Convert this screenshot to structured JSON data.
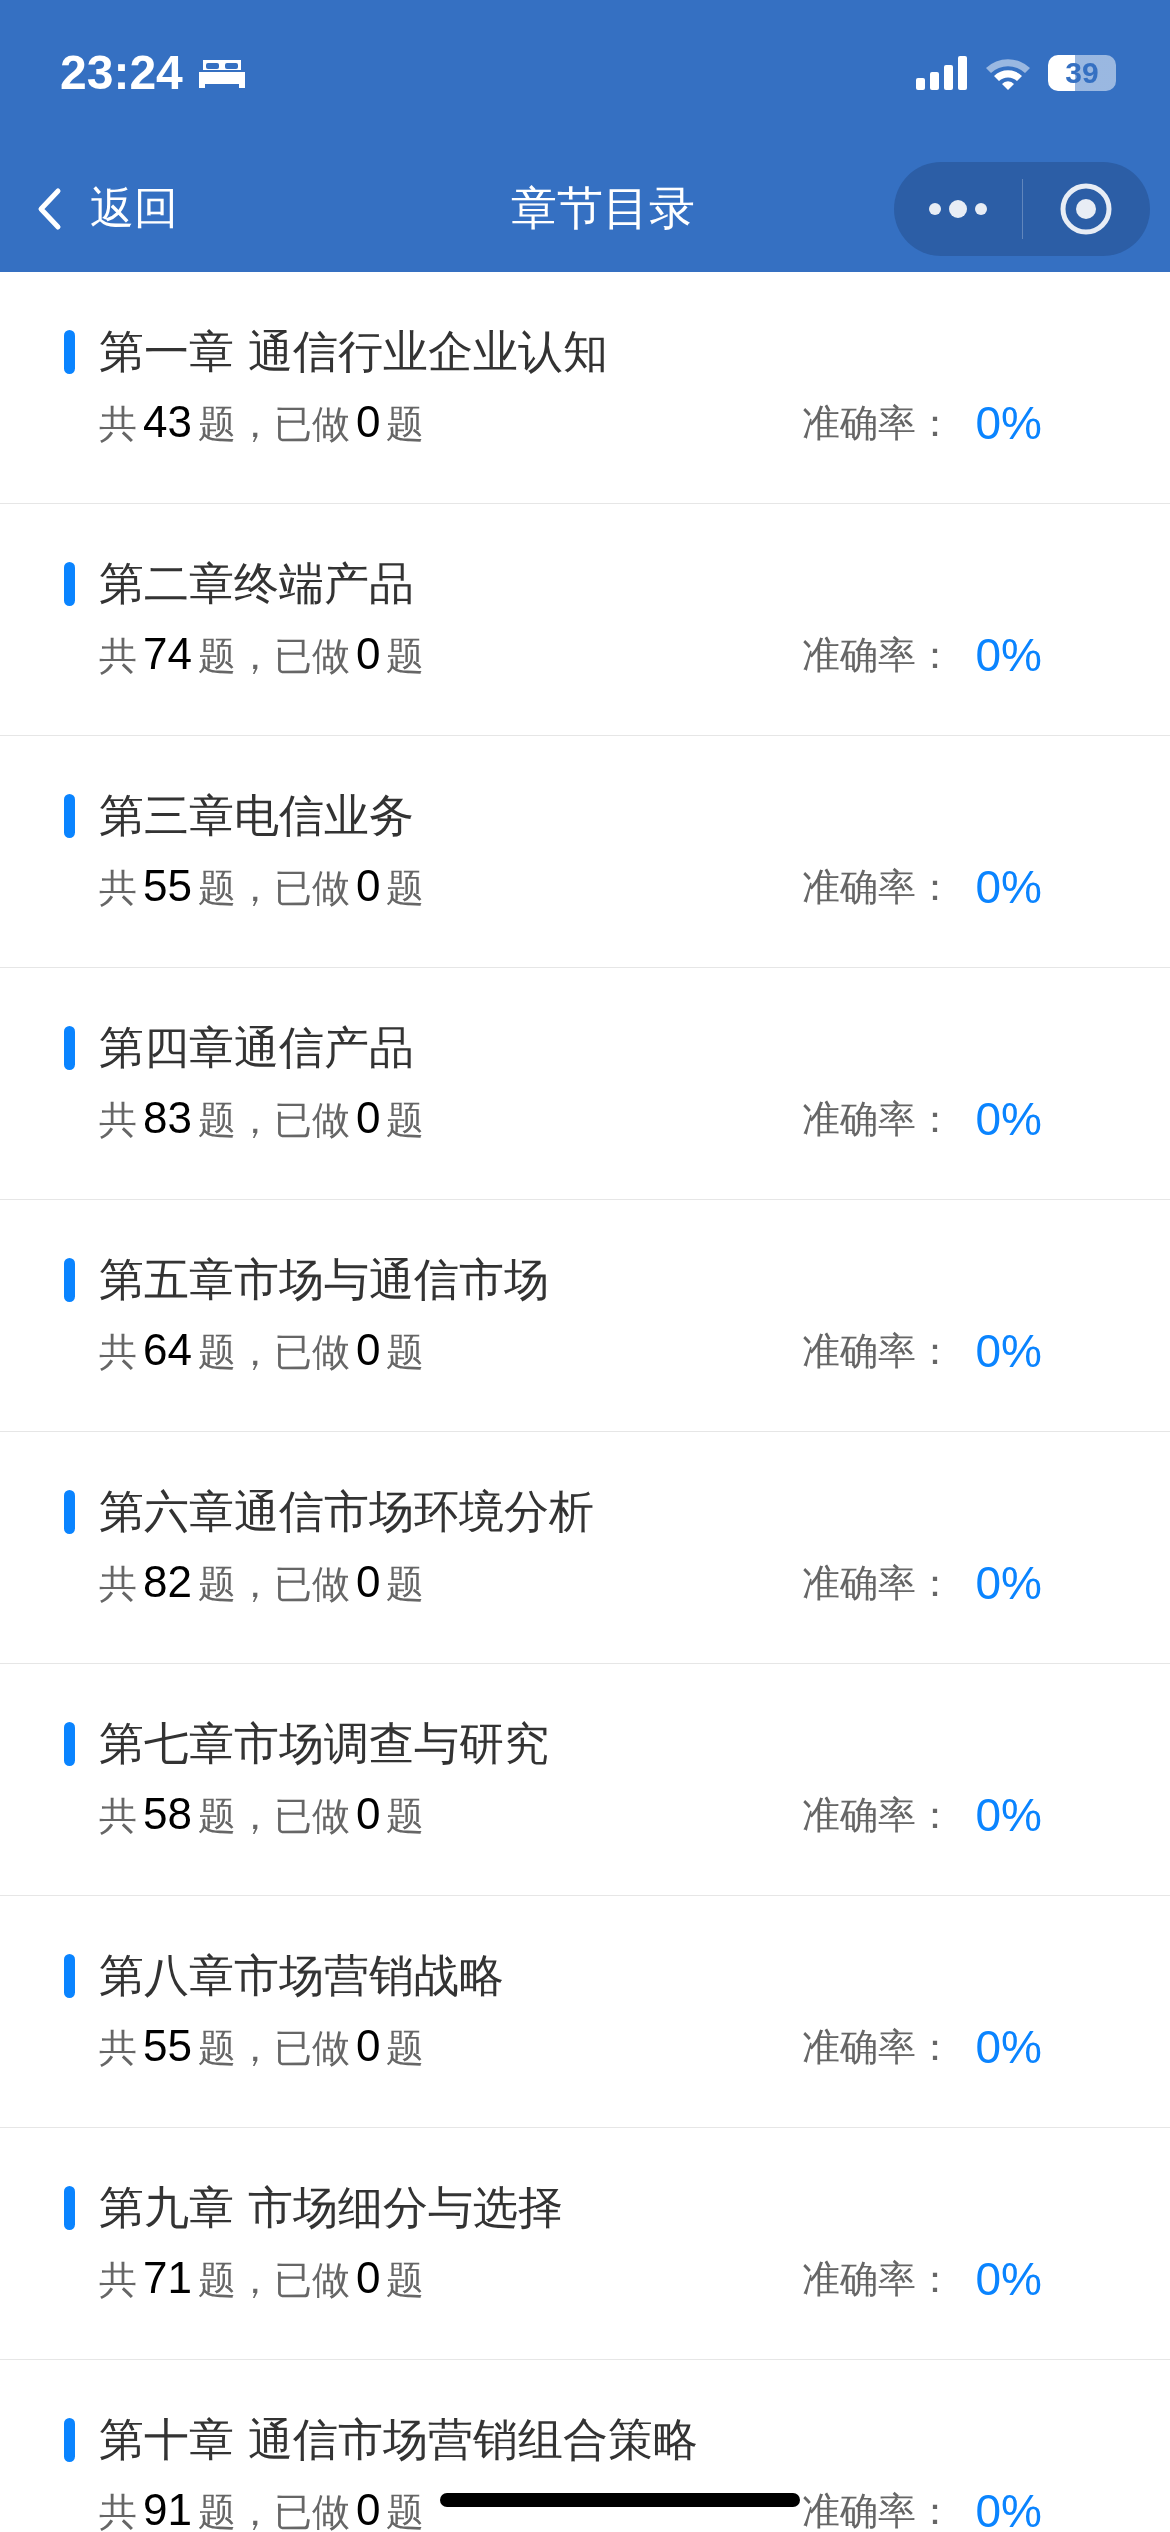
{
  "status_bar": {
    "time": "23:24",
    "battery": "39"
  },
  "nav": {
    "back": "返回",
    "title": "章节目录"
  },
  "chapters": [
    {
      "title": "第一章 通信行业企业认知",
      "stats": "共**43**题，已做**0**题",
      "accuracy_label": "准确率：",
      "accuracy": "0%"
    },
    {
      "title": "第二章终端产品",
      "stats": "共**74**题，已做**0**题",
      "accuracy_label": "准确率：",
      "accuracy": "0%"
    },
    {
      "title": "第三章电信业务",
      "stats": "共**55**题，已做**0**题",
      "accuracy_label": "准确率：",
      "accuracy": "0%"
    },
    {
      "title": "第四章通信产品",
      "stats": "共**83**题，已做**0**题",
      "accuracy_label": "准确率：",
      "accuracy": "0%"
    },
    {
      "title": "第五章市场与通信市场",
      "stats": "共**64**题，已做**0**题",
      "accuracy_label": "准确率：",
      "accuracy": "0%"
    },
    {
      "title": "第六章通信市场环境分析",
      "stats": "共**82**题，已做**0**题",
      "accuracy_label": "准确率：",
      "accuracy": "0%"
    },
    {
      "title": "第七章市场调查与研究",
      "stats": "共**58**题，已做**0**题",
      "accuracy_label": "准确率：",
      "accuracy": "0%"
    },
    {
      "title": "第八章市场营销战略",
      "stats": "共**55**题，已做**0**题",
      "accuracy_label": "准确率：",
      "accuracy": "0%"
    },
    {
      "title": "第九章 市场细分与选择",
      "stats": "共**71**题，已做**0**题",
      "accuracy_label": "准确率：",
      "accuracy": "0%"
    },
    {
      "title": "第十章 通信市场营销组合策略",
      "stats": "共**91**题，已做**0**题",
      "accuracy_label": "准确率：",
      "accuracy": "0%"
    }
  ]
}
